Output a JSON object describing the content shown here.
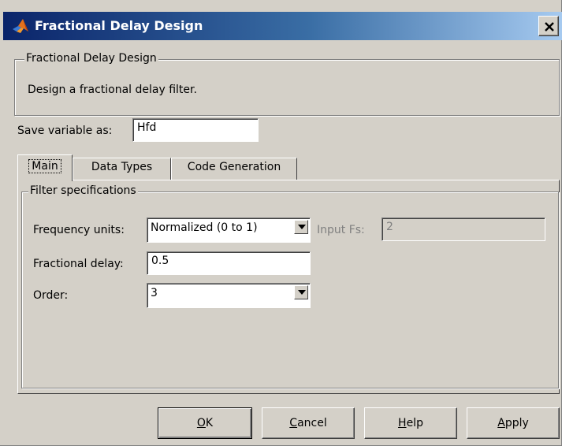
{
  "window": {
    "title": "Fractional Delay Design",
    "icon": "matlab-icon",
    "close_icon": "close-icon"
  },
  "header_group": {
    "legend": "Fractional Delay Design",
    "description": "Design a fractional delay filter."
  },
  "save_variable": {
    "label": "Save variable as:",
    "value": "Hfd"
  },
  "tabs": [
    {
      "label": "Main",
      "active": true
    },
    {
      "label": "Data Types",
      "active": false
    },
    {
      "label": "Code Generation",
      "active": false
    }
  ],
  "filter_specs": {
    "legend": "Filter specifications",
    "frequency_units": {
      "label": "Frequency units:",
      "value": "Normalized (0 to 1)"
    },
    "input_fs": {
      "label": "Input Fs:",
      "value": "2",
      "enabled": false
    },
    "fractional_delay": {
      "label": "Fractional delay:",
      "value": "0.5"
    },
    "order": {
      "label": "Order:",
      "value": "3"
    }
  },
  "buttons": {
    "ok": {
      "mnemonic": "O",
      "rest": "K"
    },
    "cancel": {
      "mnemonic": "C",
      "rest": "ancel"
    },
    "help": {
      "mnemonic": "H",
      "rest": "elp"
    },
    "apply": {
      "mnemonic": "A",
      "rest": "pply"
    }
  },
  "colors": {
    "face": "#d4d0c8",
    "titlebar_start": "#0a246a",
    "titlebar_end": "#a6caf0",
    "disabled_text": "#808080"
  }
}
